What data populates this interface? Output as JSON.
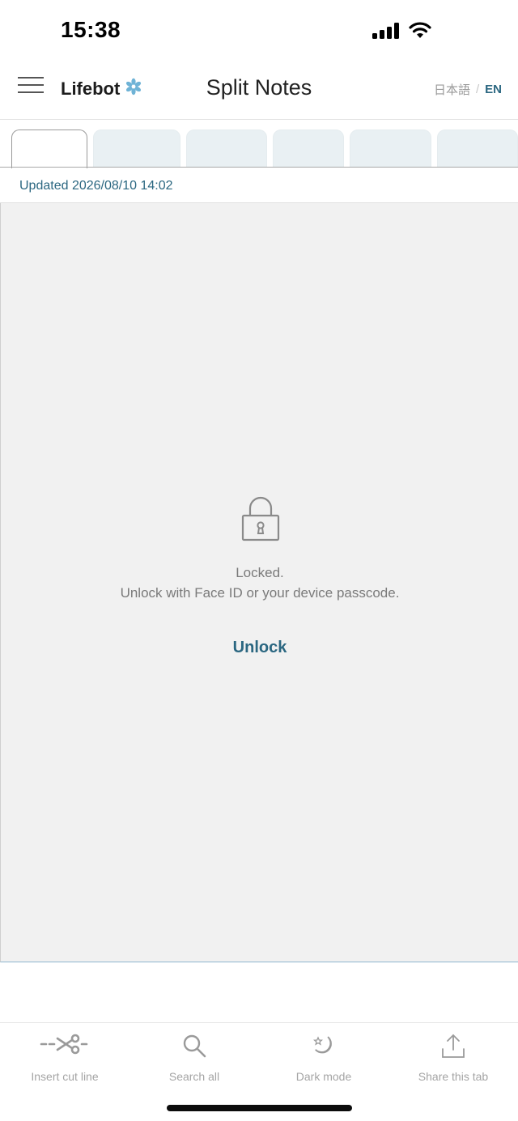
{
  "status_bar": {
    "time": "15:38"
  },
  "header": {
    "brand": "Lifebot",
    "title": "Split Notes",
    "lang_ja": "日本語",
    "lang_separator": "/",
    "lang_en": "EN"
  },
  "tabs": [
    {
      "label": "",
      "active": true
    },
    {
      "label": "",
      "active": false
    },
    {
      "label": "",
      "active": false
    },
    {
      "label": "",
      "active": false
    },
    {
      "label": "",
      "active": false
    },
    {
      "label": "",
      "active": false
    }
  ],
  "updated": {
    "text": "Updated 2026/08/10 14:02"
  },
  "lock_screen": {
    "title": "Locked.",
    "description": "Unlock with Face ID or your device passcode.",
    "unlock_label": "Unlock"
  },
  "toolbar": {
    "cut_line_label": "Insert cut line",
    "search_label": "Search all",
    "dark_mode_label": "Dark mode",
    "share_label": "Share this tab"
  },
  "colors": {
    "accent": "#2b6781",
    "content_bg": "#f1f1f1",
    "tab_inactive": "#e9f0f3",
    "muted_text": "#7a7a7a",
    "toolbar_icon": "#a4a4a4"
  }
}
